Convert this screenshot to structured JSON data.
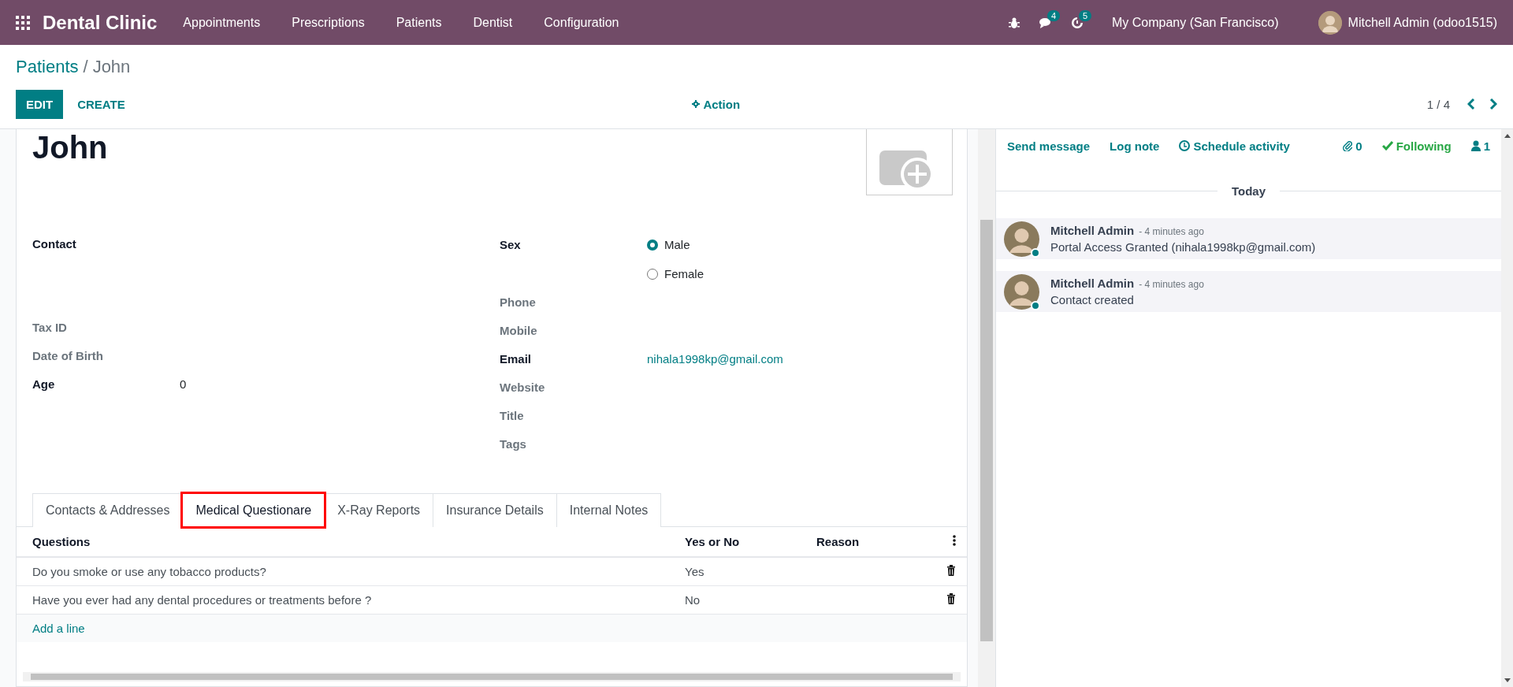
{
  "navbar": {
    "app_name": "Dental Clinic",
    "menu": [
      "Appointments",
      "Prescriptions",
      "Patients",
      "Dentist",
      "Configuration"
    ],
    "systray": [
      {
        "kind": "debug"
      },
      {
        "kind": "messages",
        "badge": "4"
      },
      {
        "kind": "activities",
        "badge": "5"
      }
    ],
    "company": "My Company (San Francisco)",
    "user": "Mitchell Admin (odoo1515)"
  },
  "breadcrumb": {
    "parent": "Patients",
    "separator": "/",
    "current": "John"
  },
  "buttons": [
    {
      "label": "EDIT",
      "primary": true
    },
    {
      "label": "CREATE",
      "primary": false
    }
  ],
  "action": "Action",
  "pager": "1 / 4",
  "record": {
    "name": "John"
  },
  "fields_left": [
    {
      "kind": "address",
      "label": "Contact",
      "bold": true
    },
    {
      "kind": "field",
      "label": "Tax ID",
      "bold": false
    },
    {
      "kind": "field",
      "label": "Date of Birth",
      "bold": false
    },
    {
      "kind": "field",
      "label": "Age",
      "bold": true,
      "value": "0"
    }
  ],
  "fields_right": [
    {
      "kind": "radio",
      "label": "Sex",
      "bold": true,
      "options": [
        {
          "label": "Male",
          "selected": true
        },
        {
          "label": "Female",
          "selected": false
        }
      ]
    },
    {
      "kind": "field",
      "label": "Phone",
      "bold": false
    },
    {
      "kind": "field",
      "label": "Mobile",
      "bold": false
    },
    {
      "kind": "link",
      "label": "Email",
      "bold": true,
      "value": "nihala1998kp@gmail.com"
    },
    {
      "kind": "field",
      "label": "Website",
      "bold": false
    },
    {
      "kind": "field",
      "label": "Title",
      "bold": false
    },
    {
      "kind": "field",
      "label": "Tags",
      "bold": false
    }
  ],
  "tabs": [
    {
      "label": "Contacts & Addresses",
      "selected": false,
      "highlighted": false
    },
    {
      "label": "Medical Questionare",
      "selected": true,
      "highlighted": true
    },
    {
      "label": "X-Ray Reports",
      "selected": false,
      "highlighted": false
    },
    {
      "label": "Insurance Details",
      "selected": false,
      "highlighted": false
    },
    {
      "label": "Internal Notes",
      "selected": false,
      "highlighted": false
    }
  ],
  "table": {
    "columns": [
      "Questions",
      "Yes or No",
      "Reason"
    ],
    "rows": [
      {
        "question": "Do you smoke or use any tobacco products?",
        "answer": "Yes"
      },
      {
        "question": "Have you ever had any dental procedures or treatments before ?",
        "answer": "No"
      }
    ],
    "add_line": "Add a line"
  },
  "chatter": {
    "actions": [
      "Send message",
      "Log note",
      "Schedule activity"
    ],
    "attachments": "0",
    "following": "Following",
    "followers": "1",
    "date_divider": "Today",
    "messages": [
      {
        "author": "Mitchell Admin",
        "time": "- 4 minutes ago",
        "body": "Portal Access Granted (nihala1998kp@gmail.com)",
        "online": true
      },
      {
        "author": "Mitchell Admin",
        "time": "- 4 minutes ago",
        "body": "Contact created",
        "online": true
      }
    ]
  }
}
